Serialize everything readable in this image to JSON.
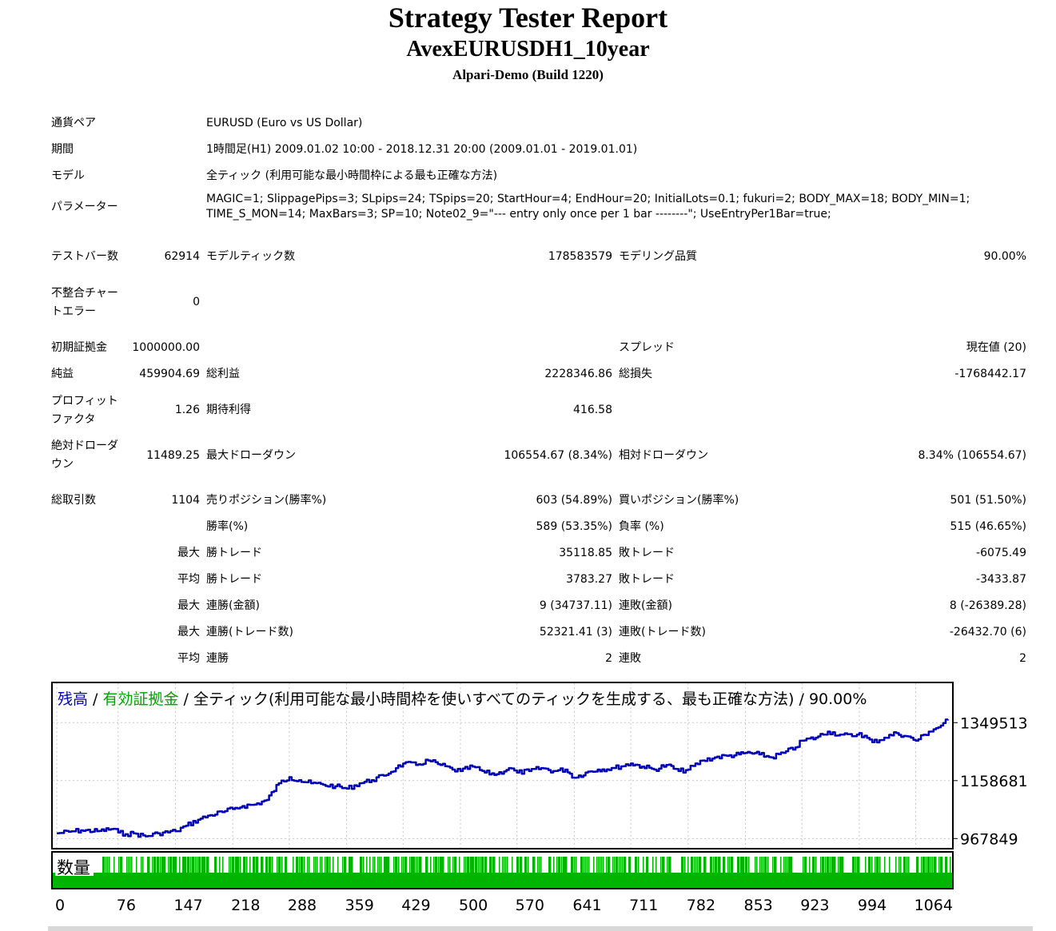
{
  "header": {
    "title": "Strategy Tester Report",
    "subtitle": "AvexEURUSDH1_10year",
    "server": "Alpari-Demo (Build 1220)"
  },
  "info": {
    "symbol_label": "通貨ペア",
    "symbol_value": "EURUSD (Euro vs US Dollar)",
    "period_label": "期間",
    "period_value": "1時間足(H1) 2009.01.02 10:00 - 2018.12.31 20:00 (2009.01.01 - 2019.01.01)",
    "model_label": "モデル",
    "model_value": "全ティック (利用可能な最小時間枠による最も正確な方法)",
    "params_label": "パラメーター",
    "params_value": "MAGIC=1; SlippagePips=3; SLpips=24; TSpips=20; StartHour=4; EndHour=20; InitialLots=0.1; fukuri=2; BODY_MAX=18; BODY_MIN=1; TIME_S_MON=14; MaxBars=3; SP=10; Note02_9=\"--- entry only once per 1 bar --------\"; UseEntryPer1Bar=true;"
  },
  "stats": {
    "bars_label": "テストバー数",
    "bars_value": "62914",
    "ticks_label": "モデルティック数",
    "ticks_value": "178583579",
    "quality_label": "モデリング品質",
    "quality_value": "90.00%",
    "mismatch_label": "不整合チャートエラー",
    "mismatch_value": "0",
    "deposit_label": "初期証拠金",
    "deposit_value": "1000000.00",
    "spread_label": "スプレッド",
    "spread_value": "現在値 (20)",
    "net_label": "純益",
    "net_value": "459904.69",
    "gross_profit_label": "総利益",
    "gross_profit_value": "2228346.86",
    "gross_loss_label": "総損失",
    "gross_loss_value": "-1768442.17",
    "pf_label": "プロフィットファクタ",
    "pf_value": "1.26",
    "payoff_label": "期待利得",
    "payoff_value": "416.58",
    "abs_dd_label": "絶対ドローダウン",
    "abs_dd_value": "11489.25",
    "max_dd_label": "最大ドローダウン",
    "max_dd_value": "106554.67 (8.34%)",
    "rel_dd_label": "相対ドローダウン",
    "rel_dd_value": "8.34% (106554.67)",
    "trades_label": "総取引数",
    "trades_value": "1104",
    "short_label": "売りポジション(勝率%)",
    "short_value": "603 (54.89%)",
    "long_label": "買いポジション(勝率%)",
    "long_value": "501 (51.50%)",
    "win_rate_label": "勝率(%)",
    "win_rate_value": "589 (53.35%)",
    "loss_rate_label": "負率 (%)",
    "loss_rate_value": "515 (46.65%)",
    "max_prefix": "最大",
    "avg_prefix": "平均",
    "largest_win_label": "勝トレード",
    "largest_win_value": "35118.85",
    "largest_loss_label": "敗トレード",
    "largest_loss_value": "-6075.49",
    "avg_win_label": "勝トレード",
    "avg_win_value": "3783.27",
    "avg_loss_label": "敗トレード",
    "avg_loss_value": "-3433.87",
    "max_consec_wins_label": "連勝(金額)",
    "max_consec_wins_value": "9 (34737.11)",
    "max_consec_losses_label": "連敗(金額)",
    "max_consec_losses_value": "8 (-26389.28)",
    "max_consec_profit_label": "連勝(トレード数)",
    "max_consec_profit_value": "52321.41 (3)",
    "max_consec_loss_label": "連敗(トレード数)",
    "max_consec_loss_value": "-26432.70 (6)",
    "avg_consec_wins_label": "連勝",
    "avg_consec_wins_value": "2",
    "avg_consec_losses_label": "連敗",
    "avg_consec_losses_value": "2"
  },
  "chart_legend": {
    "balance": "残高",
    "sep1": " / ",
    "equity": "有効証拠金",
    "sep2": " / ",
    "rest": "全ティック(利用可能な最小時間枠を使いすべてのティックを生成する、最も正確な方法) / 90.00%"
  },
  "volume_label": "数量",
  "colors": {
    "balance": "#0000b4",
    "equity": "#00a000",
    "volume": "#00b400",
    "frame": "#000000"
  },
  "chart_data": {
    "type": "line",
    "series": [
      {
        "name": "残高",
        "x": [
          0,
          15,
          30,
          50,
          70,
          76,
          85,
          95,
          110,
          125,
          147,
          160,
          175,
          190,
          205,
          218,
          230,
          245,
          260,
          275,
          288,
          300,
          315,
          330,
          345,
          359,
          375,
          390,
          405,
          420,
          429,
          445,
          460,
          475,
          490,
          500,
          515,
          530,
          545,
          560,
          570,
          585,
          600,
          615,
          630,
          641,
          655,
          670,
          690,
          711,
          725,
          740,
          755,
          770,
          782,
          800,
          815,
          830,
          845,
          853,
          870,
          885,
          900,
          915,
          923,
          940,
          955,
          970,
          985,
          994,
          1010,
          1025,
          1040,
          1052,
          1064,
          1080,
          1095,
          1104
        ],
        "values": [
          985000,
          990000,
          995000,
          992000,
          1000000,
          988000,
          982000,
          985000,
          975000,
          985000,
          992000,
          1010000,
          1030000,
          1045000,
          1055000,
          1065000,
          1075000,
          1080000,
          1095000,
          1150000,
          1170000,
          1160000,
          1150000,
          1145000,
          1140000,
          1132000,
          1150000,
          1160000,
          1175000,
          1200000,
          1215000,
          1210000,
          1225000,
          1210000,
          1195000,
          1190000,
          1205000,
          1185000,
          1180000,
          1200000,
          1185000,
          1190000,
          1200000,
          1190000,
          1195000,
          1168000,
          1185000,
          1195000,
          1200000,
          1215000,
          1205000,
          1195000,
          1210000,
          1190000,
          1195000,
          1225000,
          1235000,
          1240000,
          1245000,
          1250000,
          1245000,
          1235000,
          1250000,
          1268000,
          1290000,
          1300000,
          1320000,
          1310000,
          1305000,
          1315000,
          1285000,
          1300000,
          1315000,
          1305000,
          1290000,
          1320000,
          1340000,
          1360000
        ]
      }
    ],
    "x_ticks": [
      "0",
      "76",
      "147",
      "218",
      "288",
      "359",
      "429",
      "500",
      "570",
      "641",
      "711",
      "782",
      "853",
      "923",
      "994",
      "1064"
    ],
    "y_ticks": [
      "1349513",
      "1158681",
      "967849"
    ],
    "xlim": [
      0,
      1104
    ],
    "ylim": [
      945000,
      1445000
    ],
    "grid": true,
    "legend": "top-left"
  }
}
